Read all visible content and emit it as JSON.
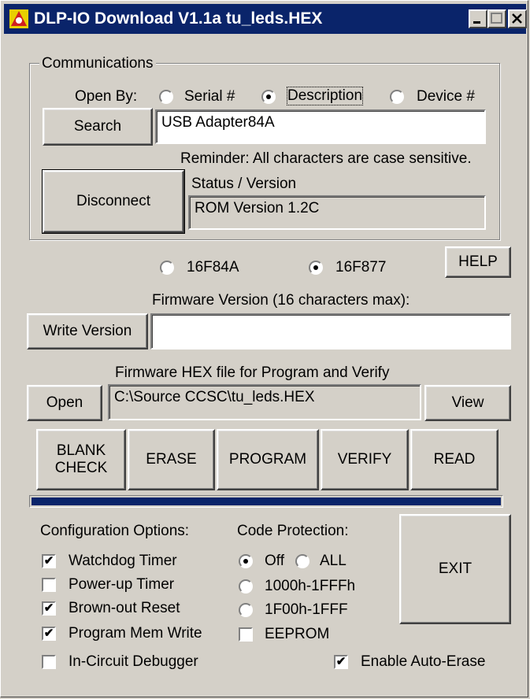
{
  "window": {
    "title": "DLP-IO Download V1.1a tu_leds.HEX",
    "controls": [
      "minimize",
      "maximize",
      "close"
    ]
  },
  "communications": {
    "group_label": "Communications",
    "open_by_label": "Open By:",
    "open_by_options": [
      {
        "label": "Serial #",
        "selected": false
      },
      {
        "label": "Description",
        "selected": true
      },
      {
        "label": "Device #",
        "selected": false
      }
    ],
    "search_button": "Search",
    "search_value": "USB Adapter84A",
    "reminder": "Reminder: All characters are case sensitive.",
    "disconnect_button": "Disconnect",
    "status_label": "Status / Version",
    "status_value": "ROM Version 1.2C"
  },
  "device": {
    "options": [
      {
        "label": "16F84A",
        "selected": false
      },
      {
        "label": "16F877",
        "selected": true
      }
    ],
    "help_button": "HELP"
  },
  "firmware_version": {
    "label": "Firmware Version (16 characters max):",
    "write_button": "Write Version",
    "value": ""
  },
  "hex_file": {
    "label": "Firmware HEX file for Program and Verify",
    "open_button": "Open",
    "path": "C:\\Source CCSC\\tu_leds.HEX",
    "view_button": "View"
  },
  "actions": {
    "blank_check_line1": "BLANK",
    "blank_check_line2": "CHECK",
    "erase": "ERASE",
    "program": "PROGRAM",
    "verify": "VERIFY",
    "read": "READ"
  },
  "progress": {
    "percent": 100,
    "color": "#0a246a"
  },
  "config": {
    "title": "Configuration Options:",
    "items": [
      {
        "label": "Watchdog Timer",
        "checked": true
      },
      {
        "label": "Power-up Timer",
        "checked": false
      },
      {
        "label": "Brown-out Reset",
        "checked": true
      },
      {
        "label": "Program Mem Write",
        "checked": true
      },
      {
        "label": "In-Circuit Debugger",
        "checked": false
      }
    ]
  },
  "code_protection": {
    "title": "Code Protection:",
    "off": {
      "label": "Off",
      "selected": true
    },
    "all": {
      "label": "ALL",
      "selected": false
    },
    "range1": {
      "label": "1000h-1FFFh",
      "selected": false
    },
    "range2": {
      "label": "1F00h-1FFF",
      "selected": false
    },
    "eeprom": {
      "label": "EEPROM",
      "checked": false
    }
  },
  "exit_button": "EXIT",
  "auto_erase": {
    "label": "Enable Auto-Erase",
    "checked": true
  },
  "check_glyph": "✔"
}
